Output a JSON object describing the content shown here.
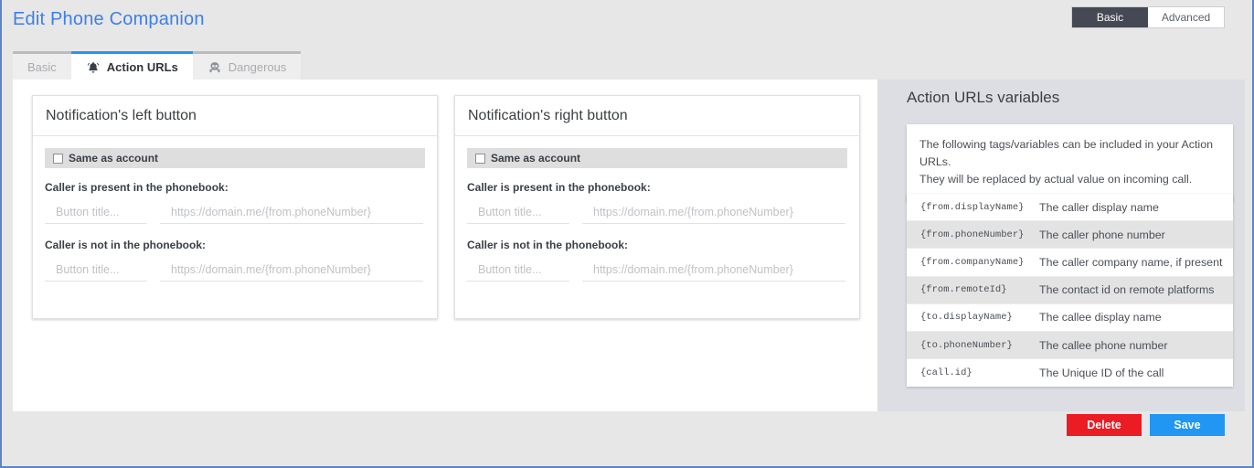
{
  "header": {
    "title": "Edit Phone Companion",
    "mode_switch": {
      "options": [
        {
          "label": "Basic",
          "active": true
        },
        {
          "label": "Advanced",
          "active": false
        }
      ]
    }
  },
  "tabs": [
    {
      "label": "Basic",
      "icon": "",
      "active": false
    },
    {
      "label": "Action URLs",
      "icon": "bell-icon",
      "active": true
    },
    {
      "label": "Dangerous",
      "icon": "skull-crossbones-icon",
      "active": false
    }
  ],
  "cards": [
    {
      "title": "Notification's left button",
      "same_as_account_label": "Same as account",
      "same_as_account_checked": false,
      "present_label": "Caller is present in the phonebook:",
      "not_present_label": "Caller is not in the phonebook:",
      "present_title_placeholder": "Button title...",
      "present_url_placeholder": "https://domain.me/{from.phoneNumber}",
      "present_title_value": "",
      "present_url_value": "",
      "notpresent_title_placeholder": "Button title...",
      "notpresent_url_placeholder": "https://domain.me/{from.phoneNumber}",
      "notpresent_title_value": "",
      "notpresent_url_value": ""
    },
    {
      "title": "Notification's right button",
      "same_as_account_label": "Same as account",
      "same_as_account_checked": false,
      "present_label": "Caller is present in the phonebook:",
      "not_present_label": "Caller is not in the phonebook:",
      "present_title_placeholder": "Button title...",
      "present_url_placeholder": "https://domain.me/{from.phoneNumber}",
      "present_title_value": "",
      "present_url_value": "",
      "notpresent_title_placeholder": "Button title...",
      "notpresent_url_placeholder": "https://domain.me/{from.phoneNumber}",
      "notpresent_title_value": "",
      "notpresent_url_value": ""
    }
  ],
  "sidebar": {
    "title": "Action URLs variables",
    "info_line1": "The following tags/variables can be included in your Action URLs.",
    "info_line2": "They will be replaced by actual value on incoming call.",
    "variables": [
      {
        "key": "{from.displayName}",
        "desc": "The caller display name"
      },
      {
        "key": "{from.phoneNumber}",
        "desc": "The caller phone number"
      },
      {
        "key": "{from.companyName}",
        "desc": "The caller company name, if present"
      },
      {
        "key": "{from.remoteId}",
        "desc": "The contact id on remote platforms"
      },
      {
        "key": "{to.displayName}",
        "desc": "The callee display name"
      },
      {
        "key": "{to.phoneNumber}",
        "desc": "The callee phone number"
      },
      {
        "key": "{call.id}",
        "desc": "The Unique ID of the call"
      }
    ]
  },
  "footer": {
    "delete_label": "Delete",
    "save_label": "Save"
  },
  "colors": {
    "title_blue": "#3d7fe8",
    "accent_blue": "#2196f3",
    "delete_red": "#ec1c24",
    "switch_dark": "#454954",
    "page_bg": "#e7e7e8",
    "sidebar_bg": "#dcdee3",
    "frame_border": "#5b85c8"
  }
}
